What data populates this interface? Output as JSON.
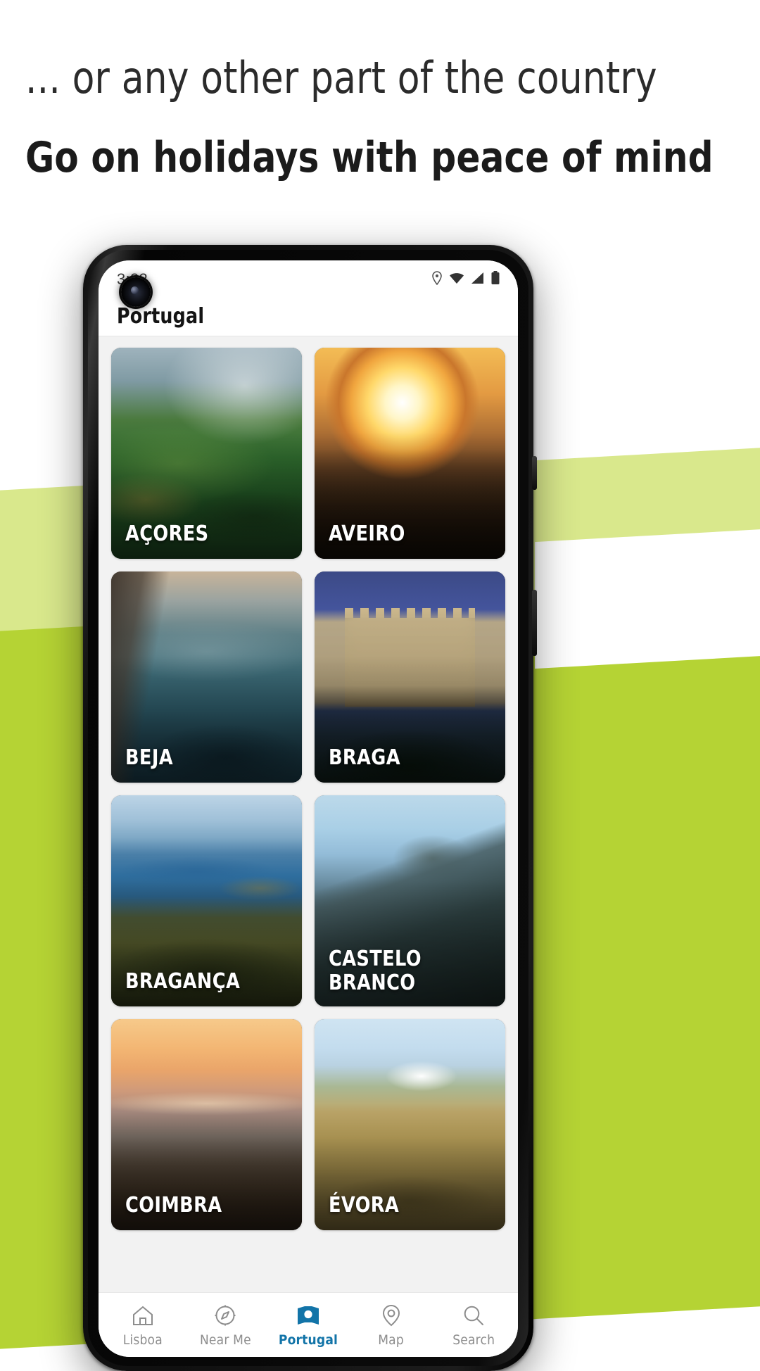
{
  "headline": {
    "line1": "... or any other part of the country",
    "line2": "Go on holidays with peace of mind"
  },
  "colors": {
    "accent": "#1274a8",
    "background_green": "#b5d334",
    "background_green_light": "#d9e88c",
    "content_grey": "#f2f2f2",
    "nav_inactive": "#8d8d8d"
  },
  "phone": {
    "statusbar": {
      "time": "3:22",
      "icons": [
        "location-icon",
        "wifi-icon",
        "signal-icon",
        "battery-icon"
      ]
    },
    "appbar": {
      "title": "Portugal"
    },
    "grid": {
      "cards": [
        {
          "label": "AÇORES",
          "image": "acores"
        },
        {
          "label": "AVEIRO",
          "image": "aveiro"
        },
        {
          "label": "BEJA",
          "image": "beja"
        },
        {
          "label": "BRAGA",
          "image": "braga"
        },
        {
          "label": "BRAGANÇA",
          "image": "braganca"
        },
        {
          "label": "CASTELO BRANCO",
          "image": "castelo-branco"
        },
        {
          "label": "COIMBRA",
          "image": "coimbra"
        },
        {
          "label": "ÉVORA",
          "image": "evora"
        }
      ]
    },
    "bottomnav": {
      "items": [
        {
          "label": "Lisboa",
          "icon": "home-icon",
          "active": false
        },
        {
          "label": "Near Me",
          "icon": "compass-icon",
          "active": false
        },
        {
          "label": "Portugal",
          "icon": "map-flag-icon",
          "active": true
        },
        {
          "label": "Map",
          "icon": "location-pin-icon",
          "active": false
        },
        {
          "label": "Search",
          "icon": "search-icon",
          "active": false
        }
      ]
    }
  }
}
